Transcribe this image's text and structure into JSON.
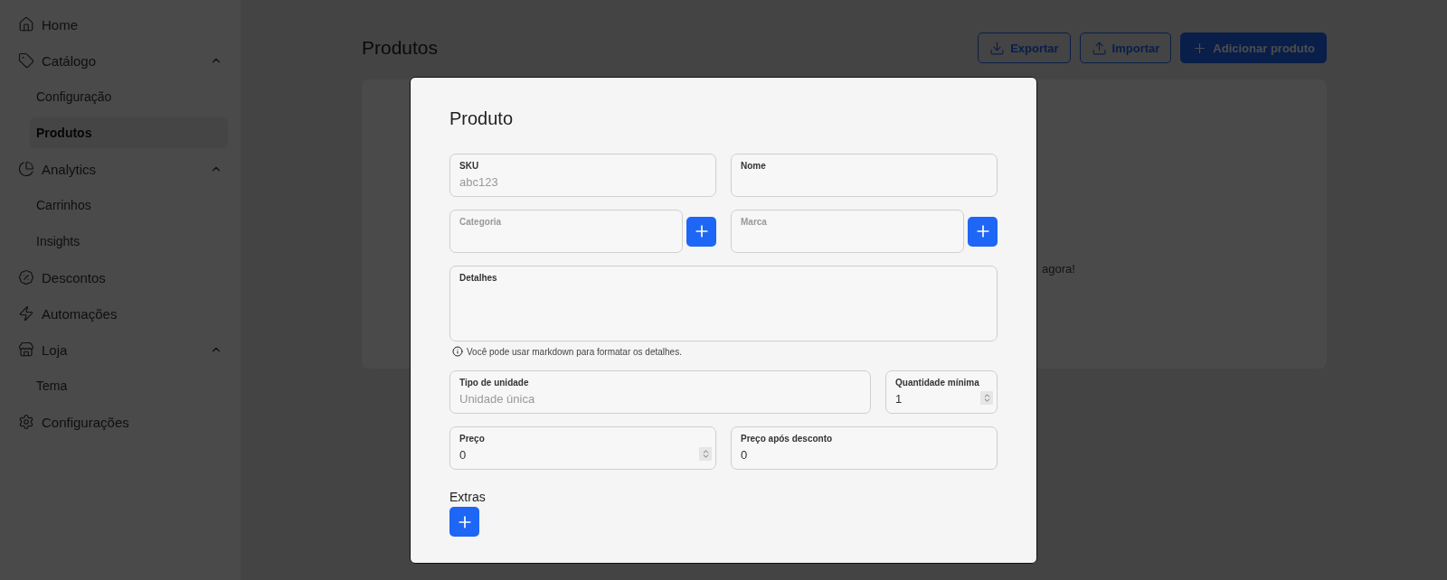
{
  "sidebar": {
    "items": [
      {
        "label": "Home",
        "selected": false
      },
      {
        "label": "Catálogo",
        "selected": false,
        "expanded": true,
        "children": [
          {
            "label": "Configuração",
            "selected": false
          },
          {
            "label": "Produtos",
            "selected": true
          }
        ]
      },
      {
        "label": "Analytics",
        "selected": false,
        "expanded": true,
        "children": [
          {
            "label": "Carrinhos",
            "selected": false
          },
          {
            "label": "Insights",
            "selected": false
          }
        ]
      },
      {
        "label": "Descontos",
        "selected": false
      },
      {
        "label": "Automações",
        "selected": false
      },
      {
        "label": "Loja",
        "selected": false,
        "expanded": true,
        "children": [
          {
            "label": "Tema",
            "selected": false
          }
        ]
      },
      {
        "label": "Configurações",
        "selected": false
      }
    ]
  },
  "page": {
    "title": "Produtos",
    "actions": [
      {
        "kind": "export",
        "label": "Exportar"
      },
      {
        "kind": "import",
        "label": "Importar"
      },
      {
        "kind": "add",
        "label": "Adicionar produto"
      }
    ],
    "empty_message": "agora!"
  },
  "modal": {
    "title": "Produto",
    "rows": [
      {
        "fields": [
          {
            "kind": "text",
            "label": "SKU",
            "placeholder": "abc123"
          },
          {
            "kind": "text",
            "label": "Nome"
          }
        ]
      },
      {
        "fields": [
          {
            "kind": "select-add",
            "label": "Categoria"
          },
          {
            "kind": "select-add",
            "label": "Marca"
          }
        ]
      },
      {
        "fields": [
          {
            "kind": "textarea",
            "label": "Detalhes"
          }
        ]
      },
      {
        "hint": "Você pode usar markdown para formatar os detalhes."
      },
      {
        "fields": [
          {
            "kind": "text",
            "label": "Tipo de unidade",
            "placeholder": "Unidade única"
          },
          {
            "kind": "quantity",
            "label": "Quantidade mínima",
            "value": "1"
          }
        ]
      },
      {
        "fields": [
          {
            "kind": "number",
            "label": "Preço",
            "value": "0"
          },
          {
            "kind": "text",
            "label": "Preço após desconto",
            "value": "0"
          }
        ]
      }
    ],
    "extras_title": "Extras"
  }
}
